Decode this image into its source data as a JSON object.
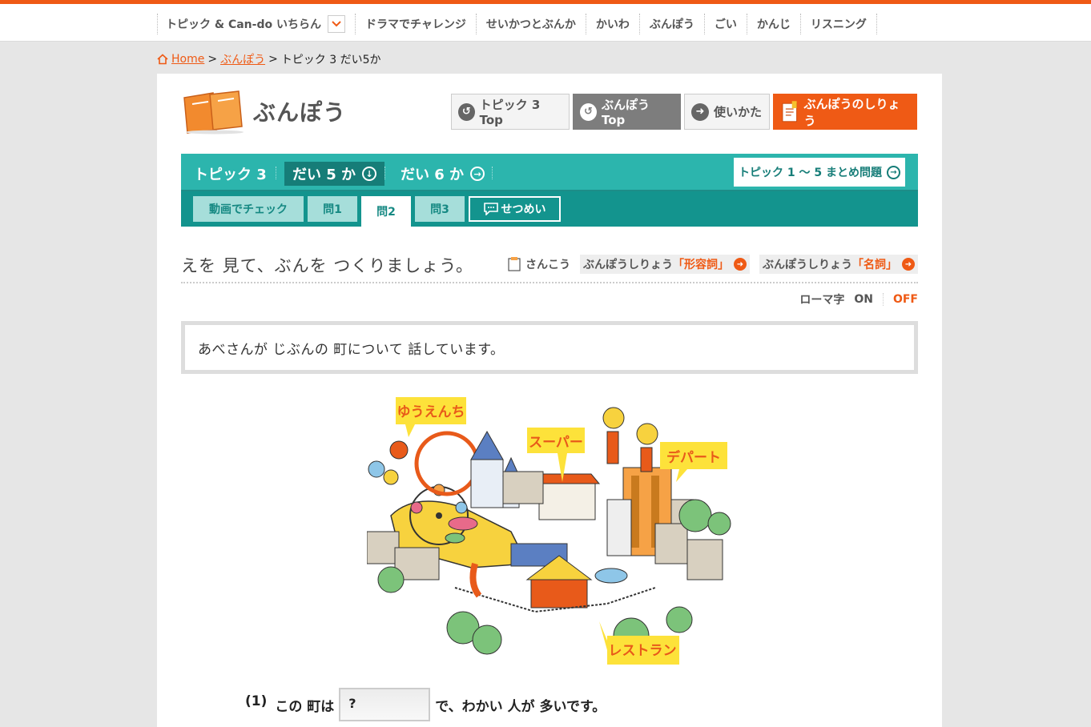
{
  "topnav": {
    "items": [
      "トピック & Can-do いちらん",
      "ドラマでチャレンジ",
      "せいかつとぶんか",
      "かいわ",
      "ぶんぽう",
      "ごい",
      "かんじ",
      "リスニング"
    ]
  },
  "breadcrumb": {
    "home": "Home",
    "sep1": ">",
    "section": "ぶんぽう",
    "sep2": ">",
    "current": "トピック 3 だい5か"
  },
  "header": {
    "title": "ぶんぽう",
    "buttons": {
      "topic_top": "トピック 3 Top",
      "bunpou_top": "ぶんぽう Top",
      "howto": "使いかた",
      "materials": "ぶんぽうのしりょう"
    }
  },
  "lesson_tabs": {
    "topic": "トピック 3",
    "lesson5": "だい 5 か",
    "lesson6": "だい 6 か",
    "summary": "トピック 1 〜 5 まとめ問題"
  },
  "question_tabs": {
    "video": "動画でチェック",
    "q1": "問1",
    "q2": "問2",
    "q3": "問3",
    "explain": "せつめい"
  },
  "instruction": {
    "text": "えを 見て、ぶんを つくりましょう。",
    "reference_label": "さんこう",
    "ref1_prefix": "ぶんぽうしりょう",
    "ref1_highlight": "「形容詞」",
    "ref2_prefix": "ぶんぽうしりょう",
    "ref2_highlight": "「名詞」"
  },
  "romaji": {
    "label": "ローマ字",
    "on": "ON",
    "off": "OFF"
  },
  "context_text": "あべさんが じぶんの 町について 話しています。",
  "illustration": {
    "labels": {
      "amusement": "ゆうえんち",
      "super": "スーパー",
      "department": "デパート",
      "restaurant": "レストラン"
    }
  },
  "question": {
    "number": "(1)",
    "before": "この 町は",
    "answer": "?",
    "after": "で、わかい 人が 多いです。"
  },
  "colors": {
    "accent": "#ef5a15",
    "teal": "#2cb5ad",
    "teal_dark": "#13948e"
  }
}
